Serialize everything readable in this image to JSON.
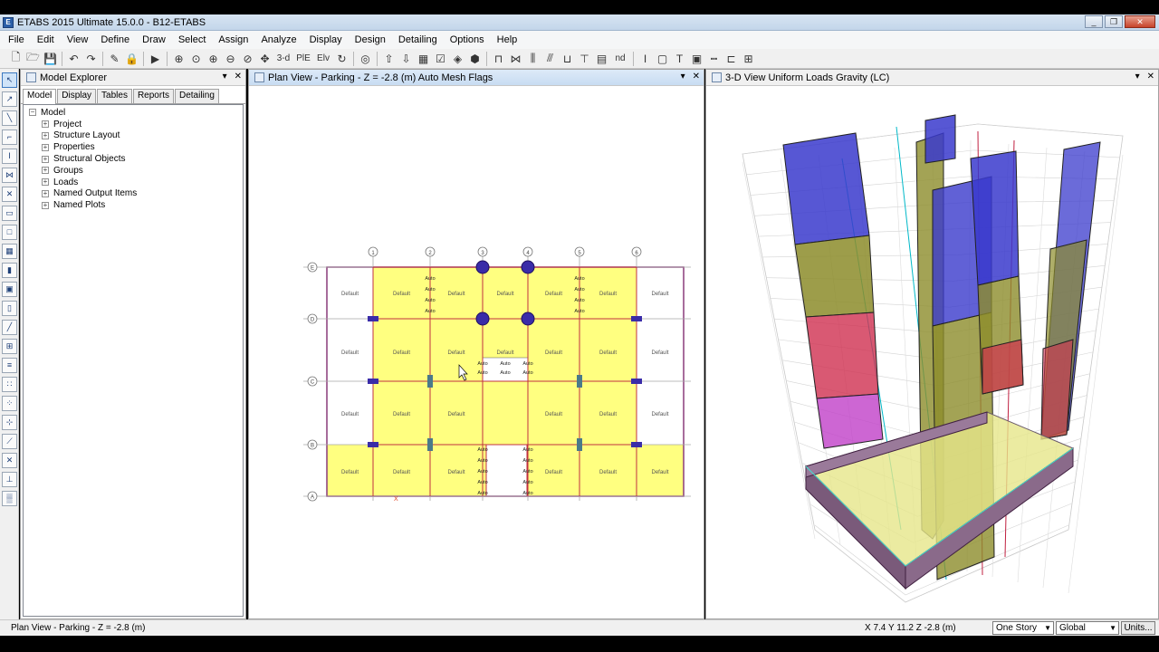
{
  "app": {
    "title": "ETABS 2015 Ultimate 15.0.0 - B12-ETABS",
    "icon_label": "E"
  },
  "window_buttons": [
    "minimize-icon",
    "restore-icon",
    "close-icon"
  ],
  "menu": [
    "File",
    "Edit",
    "View",
    "Define",
    "Draw",
    "Select",
    "Assign",
    "Analyze",
    "Display",
    "Design",
    "Detailing",
    "Options",
    "Help"
  ],
  "toolbar": {
    "three_d_label": "3-d",
    "plan_label": "PlE",
    "elev_label": "Elv",
    "nd_label": "nd"
  },
  "explorer": {
    "title": "Model Explorer",
    "tabs": [
      "Model",
      "Display",
      "Tables",
      "Reports",
      "Detailing"
    ],
    "root": "Model",
    "items": [
      "Project",
      "Structure Layout",
      "Properties",
      "Structural Objects",
      "Groups",
      "Loads",
      "Named Output Items",
      "Named Plots"
    ],
    "expand_glyph": "+",
    "collapse_glyph": "−"
  },
  "plan_view": {
    "title": "Plan View - Parking - Z = -2.8 (m)  Auto Mesh Flags",
    "grid_columns": [
      "1",
      "2",
      "3",
      "4",
      "5",
      "6"
    ],
    "grid_rows": [
      "E",
      "D",
      "C",
      "B",
      "A"
    ],
    "area_label": "Default",
    "mesh_label": "Auto",
    "axis_mark": "X"
  },
  "view_3d": {
    "title": "3-D View  Uniform Loads Gravity  (LC)",
    "colors": {
      "blue": "#3a3acc",
      "olive": "#8c8c2a",
      "red": "#d03050",
      "magenta": "#c040c8",
      "slab": "#e6e68a"
    }
  },
  "panel_controls": {
    "dropdown": "▾",
    "close": "✕"
  },
  "status": {
    "view_text": "Plan View - Parking - Z = -2.8 (m)",
    "coords": "X 7.4  Y 11.2  Z -2.8 (m)",
    "story_option": "One Story",
    "coord_system": "Global",
    "units_button": "Units..."
  },
  "colors": {
    "slab_yellow": "#ffff80",
    "beam_red": "#c03040",
    "column_blue": "#3a2ca8",
    "grid_gray": "#a8a8a8"
  }
}
